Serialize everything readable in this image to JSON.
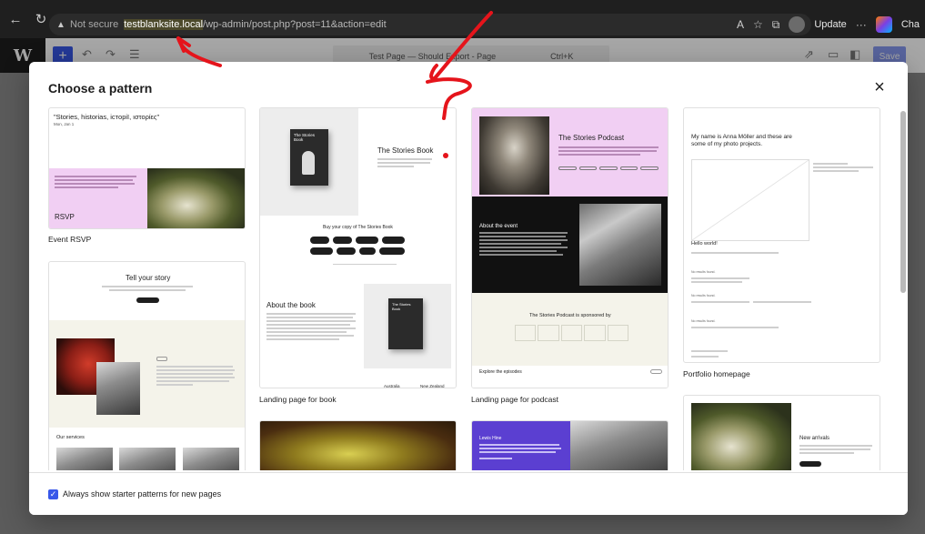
{
  "browser": {
    "not_secure": "Not secure",
    "host": "testblanksite.local",
    "path": "/wp-admin/post.php?post=11&action=edit",
    "update_label": "Update",
    "more": "···",
    "ext_label": "Cha"
  },
  "editor": {
    "logo": "W",
    "doc_title": "Test Page — Should Export - Page",
    "shortcut": "Ctrl+K",
    "save_label": "Save"
  },
  "modal": {
    "title": "Choose a pattern",
    "close_symbol": "×",
    "footer_checkbox_label": "Always show starter patterns for new pages",
    "patterns": [
      {
        "label": "Event RSVP",
        "heading": "\"Stories, historias, історії, ιστορίες\"",
        "date": "Mon, Jan 1",
        "rsvp": "RSVP"
      },
      {
        "label": "Landing page for book",
        "book_title": "The Stories Book",
        "cover_title": "The Stories Book",
        "buy_heading": "Buy your copy of The Stories Book",
        "about_heading": "About the book",
        "footer_left": "Australia",
        "footer_right": "New Zealand"
      },
      {
        "label": "Landing page for podcast",
        "podcast_title": "The Stories Podcast",
        "about_event": "About the event",
        "sponsor": "The Stories Podcast is sponsored by",
        "explore": "Explore the episodes"
      },
      {
        "label": "Portfolio homepage",
        "intro": "My name is Anna Möller and these are some of my photo projects.",
        "hello": "Hello world!",
        "no_results": "No results found."
      },
      {
        "label": "",
        "heading": "Tell your story",
        "services": "Our services"
      },
      {
        "label": "",
        "note": "yellow flower photo"
      },
      {
        "label": "",
        "name": "Lewis Hine"
      },
      {
        "label": "",
        "heading": "New arrivals"
      }
    ]
  },
  "colors": {
    "wp_blue": "#3858e9",
    "pink": "#f1cff3",
    "annotation_red": "#e5141b",
    "highlight": "#d4c22c"
  }
}
